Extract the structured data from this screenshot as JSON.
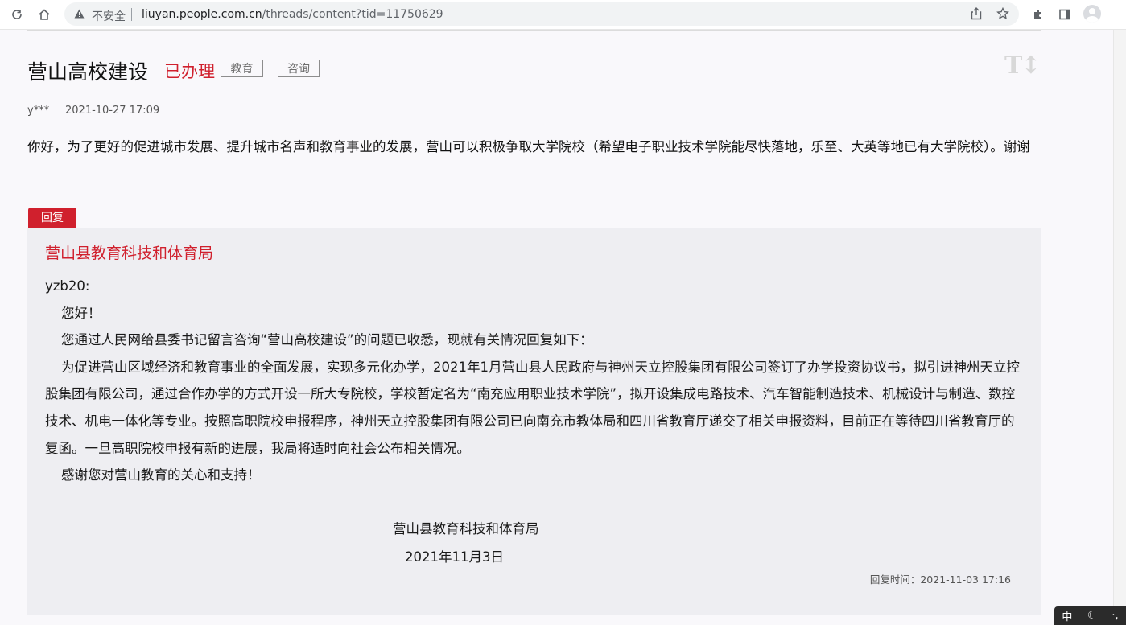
{
  "browser": {
    "insecure_label": "不安全",
    "url_host": "liuyan.people.com.cn",
    "url_path": "/threads/content?tid=11750629",
    "icons": [
      "reload-icon",
      "home-icon",
      "warning-icon",
      "share-icon",
      "star-icon",
      "extensions-icon",
      "sidepanel-icon",
      "profile-icon"
    ]
  },
  "thread": {
    "title": "营山高校建设",
    "status": "已办理",
    "tags": [
      "教育",
      "咨询"
    ],
    "font_tool": "T↕",
    "user": "y***",
    "time": "2021-10-27 17:09",
    "content": "你好，为了更好的促进城市发展、提升城市名声和教育事业的发展，营山可以积极争取大学院校（希望电子职业技术学院能尽快落地，乐至、大英等地已有大学院校）。谢谢"
  },
  "reply": {
    "tab_label": "回复",
    "org": "营山县教育科技和体育局",
    "salutation": "yzb20:",
    "greeting": "您好！",
    "para1": "您通过人民网给县委书记留言咨询“营山高校建设”的问题已收悉，现就有关情况回复如下：",
    "para2": "为促进营山区域经济和教育事业的全面发展，实现多元化办学，2021年1月营山县人民政府与神州天立控股集团有限公司签订了办学投资协议书，拟引进神州天立控股集团有限公司，通过合作办学的方式开设一所大专院校，学校暂定名为“南充应用职业技术学院”，拟开设集成电路技术、汽车智能制造技术、机械设计与制造、数控技术、机电一体化等专业。按照高职院校申报程序，神州天立控股集团有限公司已向南充市教体局和四川省教育厅递交了相关申报资料，目前正在等待四川省教育厅的复函。一旦高职院校申报有新的进展，我局将适时向社会公布相关情况。",
    "thanks": "感谢您对营山教育的关心和支持！",
    "sign_org": "营山县教育科技和体育局",
    "sign_date": "2021年11月3日",
    "reply_time": "回复时间：2021-11-03 17:16"
  },
  "ime": {
    "mode": "中",
    "moon": "☾",
    "punct": "·,"
  },
  "colors": {
    "accent_red": "#d0202d",
    "reply_bg": "#eeeef2",
    "page_bg": "#f9f8fb"
  }
}
